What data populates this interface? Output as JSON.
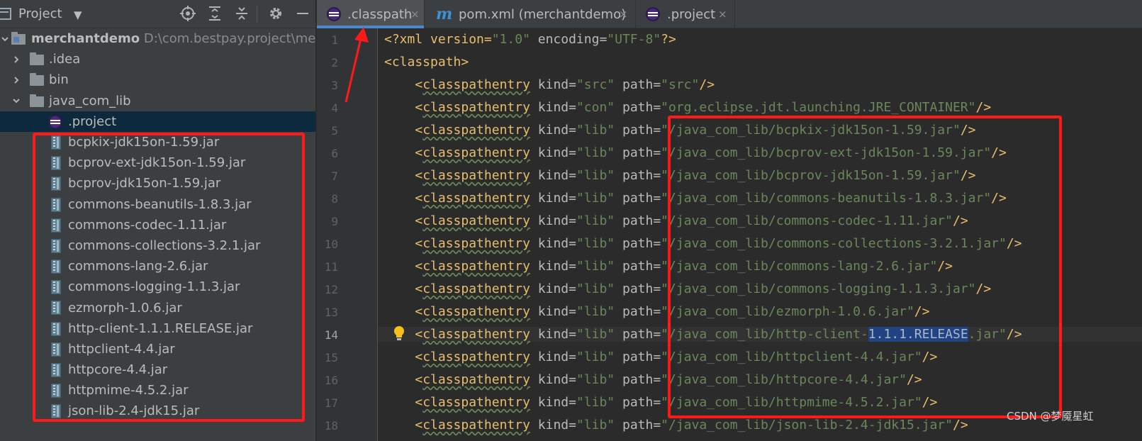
{
  "project_panel": {
    "title": "Project",
    "dropdown": "▼",
    "tree": [
      {
        "label": "merchantdemo",
        "path": "D:\\com.bestpay.project\\merchantdemo",
        "kind": "module",
        "expanded": true
      },
      {
        "label": ".idea",
        "kind": "folder",
        "expanded": false
      },
      {
        "label": "bin",
        "kind": "folder",
        "expanded": false
      },
      {
        "label": "java_com_lib",
        "kind": "folder",
        "expanded": true
      },
      {
        "label": ".project",
        "kind": "eclipse-file",
        "selected": true
      },
      {
        "label": "bcpkix-jdk15on-1.59.jar",
        "kind": "jar"
      },
      {
        "label": "bcprov-ext-jdk15on-1.59.jar",
        "kind": "jar"
      },
      {
        "label": "bcprov-jdk15on-1.59.jar",
        "kind": "jar"
      },
      {
        "label": "commons-beanutils-1.8.3.jar",
        "kind": "jar"
      },
      {
        "label": "commons-codec-1.11.jar",
        "kind": "jar"
      },
      {
        "label": "commons-collections-3.2.1.jar",
        "kind": "jar"
      },
      {
        "label": "commons-lang-2.6.jar",
        "kind": "jar"
      },
      {
        "label": "commons-logging-1.1.3.jar",
        "kind": "jar"
      },
      {
        "label": "ezmorph-1.0.6.jar",
        "kind": "jar"
      },
      {
        "label": "http-client-1.1.1.RELEASE.jar",
        "kind": "jar"
      },
      {
        "label": "httpclient-4.4.jar",
        "kind": "jar"
      },
      {
        "label": "httpcore-4.4.jar",
        "kind": "jar"
      },
      {
        "label": "httpmime-4.5.2.jar",
        "kind": "jar"
      },
      {
        "label": "json-lib-2.4-jdk15.jar",
        "kind": "jar"
      }
    ]
  },
  "tabs": [
    {
      "label": ".classpath",
      "icon": "eclipse-icon",
      "active": true,
      "close": "×"
    },
    {
      "label": "pom.xml (merchantdemo)",
      "icon": "maven-icon",
      "icon_glyph": "m",
      "active": false,
      "close": "×"
    },
    {
      "label": ".project",
      "icon": "eclipse-icon",
      "active": false,
      "close": "×"
    }
  ],
  "editor": {
    "current_line": 14,
    "xml_decl": {
      "start": "<?xml version=",
      "version": "\"1.0\"",
      "mid": " encoding=",
      "encoding": "\"UTF-8\"",
      "end": "?>"
    },
    "root_tag": "<classpath>",
    "entry_tag": "<classpathentry",
    "kind_attr": "kind=",
    "path_attr": "path=",
    "close": "/>",
    "entries": [
      {
        "line": 3,
        "kind": "\"src\"",
        "path": "\"src\""
      },
      {
        "line": 4,
        "kind": "\"con\"",
        "path": "\"org.eclipse.jdt.launching.JRE_CONTAINER\""
      },
      {
        "line": 5,
        "kind": "\"lib\"",
        "path": "\"/java_com_lib/bcpkix-jdk15on-1.59.jar\""
      },
      {
        "line": 6,
        "kind": "\"lib\"",
        "path": "\"/java_com_lib/bcprov-ext-jdk15on-1.59.jar\""
      },
      {
        "line": 7,
        "kind": "\"lib\"",
        "path": "\"/java_com_lib/bcprov-jdk15on-1.59.jar\""
      },
      {
        "line": 8,
        "kind": "\"lib\"",
        "path": "\"/java_com_lib/commons-beanutils-1.8.3.jar\""
      },
      {
        "line": 9,
        "kind": "\"lib\"",
        "path": "\"/java_com_lib/commons-codec-1.11.jar\""
      },
      {
        "line": 10,
        "kind": "\"lib\"",
        "path": "\"/java_com_lib/commons-collections-3.2.1.jar\""
      },
      {
        "line": 11,
        "kind": "\"lib\"",
        "path": "\"/java_com_lib/commons-lang-2.6.jar\""
      },
      {
        "line": 12,
        "kind": "\"lib\"",
        "path": "\"/java_com_lib/commons-logging-1.1.3.jar\""
      },
      {
        "line": 13,
        "kind": "\"lib\"",
        "path": "\"/java_com_lib/ezmorph-1.0.6.jar\""
      },
      {
        "line": 14,
        "kind": "\"lib\"",
        "path_pre": "\"/java_com_lib/http-client-",
        "path_sel": "1.1.1.RELEASE",
        "path_post": ".jar\""
      },
      {
        "line": 15,
        "kind": "\"lib\"",
        "path": "\"/java_com_lib/httpclient-4.4.jar\""
      },
      {
        "line": 16,
        "kind": "\"lib\"",
        "path": "\"/java_com_lib/httpcore-4.4.jar\""
      },
      {
        "line": 17,
        "kind": "\"lib\"",
        "path": "\"/java_com_lib/httpmime-4.5.2.jar\""
      },
      {
        "line": 18,
        "kind": "\"lib\"",
        "path": "\"/java_com_lib/json-lib-2.4-jdk15.jar\""
      }
    ]
  },
  "watermark": "CSDN @梦魇星虹",
  "colors": {
    "annotation_red": "#ff1a1a",
    "tag": "#e8bf6a",
    "string": "#6a8759",
    "attribute": "#bababa",
    "selection": "#214283",
    "tab_underline": "#4a88c7"
  }
}
